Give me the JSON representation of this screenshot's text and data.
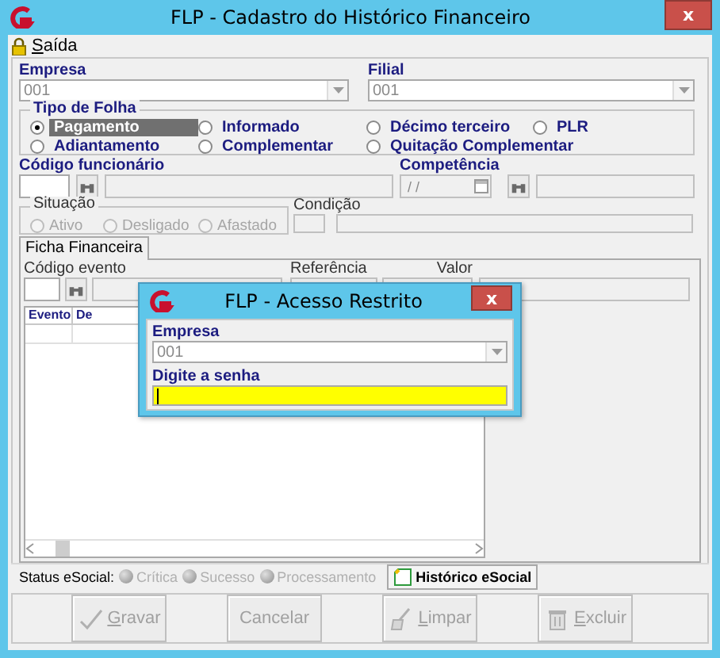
{
  "window": {
    "title": "FLP - Cadastro do Histórico Financeiro",
    "close": "x"
  },
  "menu": [
    {
      "label": "Saída",
      "mnemonic": true
    }
  ],
  "empresa": {
    "label": "Empresa",
    "value": "001"
  },
  "filial": {
    "label": "Filial",
    "value": "001"
  },
  "tipo_de_folha": {
    "title": "Tipo de Folha",
    "options": [
      {
        "label": "Pagamento",
        "selected": true
      },
      {
        "label": "Informado",
        "selected": false
      },
      {
        "label": "Décimo terceiro",
        "selected": false
      },
      {
        "label": "PLR",
        "selected": false
      },
      {
        "label": "Adiantamento",
        "selected": false
      },
      {
        "label": "Complementar",
        "selected": false
      },
      {
        "label": "Quitação Complementar",
        "selected": false
      }
    ]
  },
  "codigo_funcionario": {
    "label": "Código funcionário"
  },
  "competencia": {
    "label": "Competência",
    "value": "/ /"
  },
  "situacao": {
    "title": "Situação",
    "disabled": true,
    "options": [
      {
        "label": "Ativo",
        "selected": false
      },
      {
        "label": "Desligado",
        "selected": false
      },
      {
        "label": "Afastado",
        "selected": false
      }
    ]
  },
  "condicao": {
    "label": "Condição"
  },
  "tabs": [
    {
      "label": "Ficha Financeira",
      "selected": true
    }
  ],
  "evento": {
    "codigo_label": "Código evento",
    "referencia_label": "Referência",
    "valor_label": "Valor"
  },
  "grid": {
    "columns": [
      "Evento",
      "De"
    ]
  },
  "status_esocial": {
    "label": "Status eSocial:",
    "indicators": [
      {
        "label": "Crítica",
        "disabled": true
      },
      {
        "label": "Sucesso",
        "disabled": true
      },
      {
        "label": "Processamento",
        "disabled": true
      }
    ],
    "button": "Histórico eSocial"
  },
  "buttons": [
    {
      "label": "Gravar",
      "kind": "check",
      "disabled": true,
      "mnemonic": true
    },
    {
      "label": "Cancelar",
      "kind": "plain",
      "disabled": true,
      "mnemonic": false
    },
    {
      "label": "Limpar",
      "kind": "broom",
      "disabled": true,
      "mnemonic": true
    },
    {
      "label": "Excluir",
      "kind": "trash",
      "disabled": true,
      "mnemonic": true
    }
  ],
  "dialog": {
    "title": "FLP - Acesso Restrito",
    "close": "x",
    "empresa": {
      "label": "Empresa",
      "value": "001"
    },
    "password": {
      "label": "Digite a senha",
      "focused": true
    }
  }
}
